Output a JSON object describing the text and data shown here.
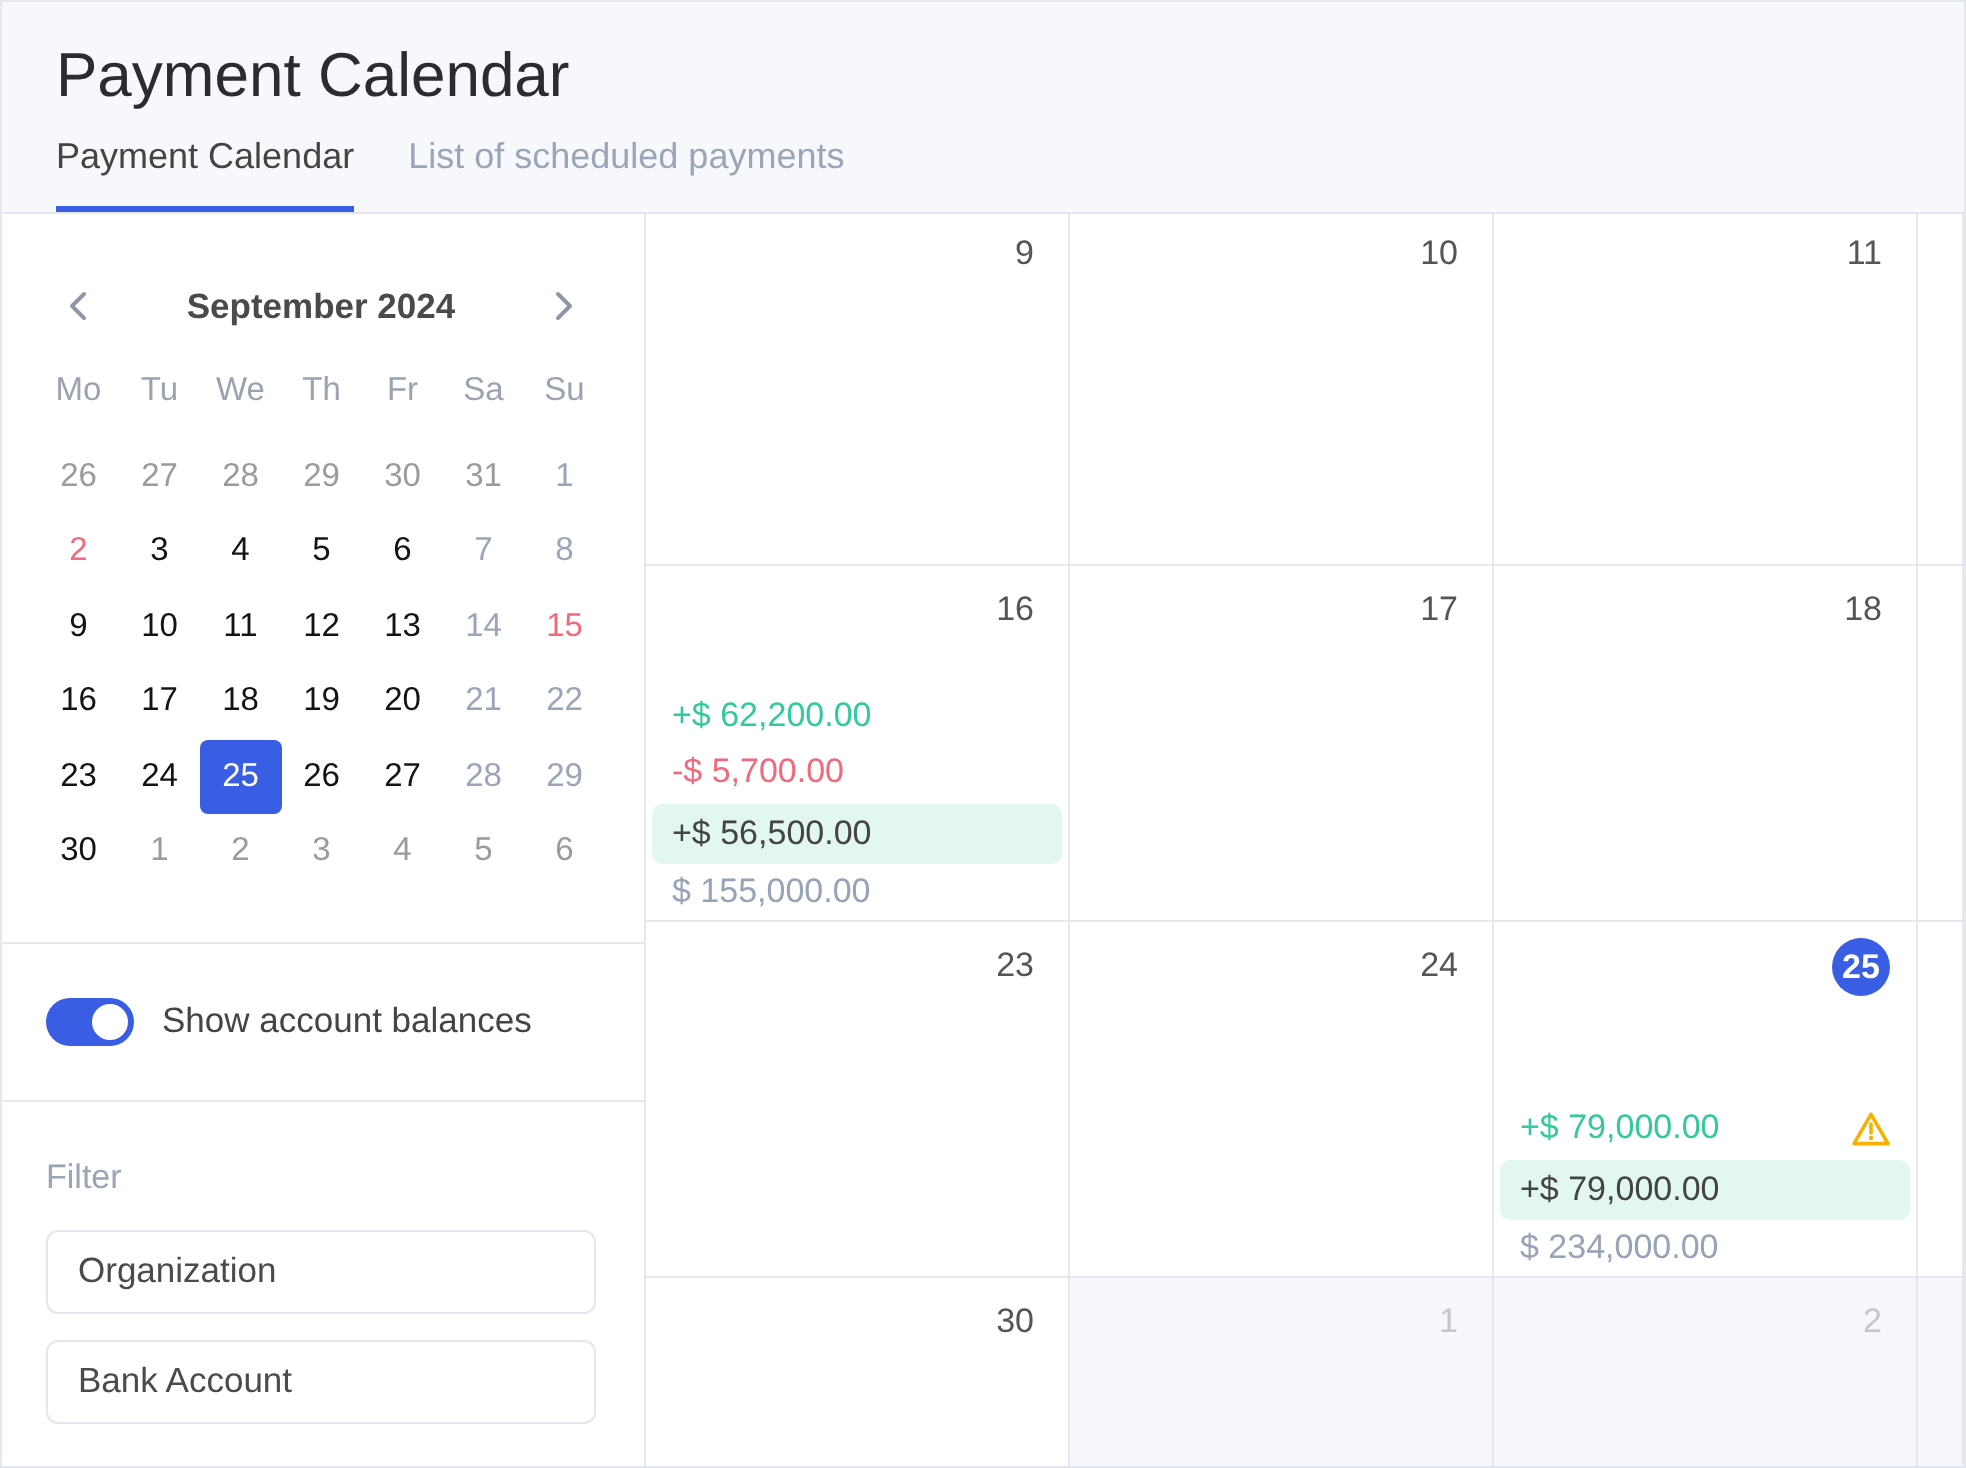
{
  "page": {
    "title": "Payment Calendar"
  },
  "tabs": [
    {
      "label": "Payment Calendar",
      "selected": true
    },
    {
      "label": "List of scheduled payments",
      "selected": false
    }
  ],
  "mini_calendar": {
    "month": "September 2024",
    "weekdays": [
      "Mo",
      "Tu",
      "We",
      "Th",
      "Fr",
      "Sa",
      "Su"
    ],
    "weeks": [
      [
        {
          "day": "26",
          "kind": "outside",
          "selected": false
        },
        {
          "day": "27",
          "kind": "outside",
          "selected": false
        },
        {
          "day": "28",
          "kind": "outside",
          "selected": false
        },
        {
          "day": "29",
          "kind": "outside",
          "selected": false
        },
        {
          "day": "30",
          "kind": "outside",
          "selected": false
        },
        {
          "day": "31",
          "kind": "outside",
          "selected": false
        },
        {
          "day": "1",
          "kind": "weekend",
          "selected": false
        }
      ],
      [
        {
          "day": "2",
          "kind": "holiday",
          "selected": false
        },
        {
          "day": "3",
          "kind": "workday",
          "selected": false
        },
        {
          "day": "4",
          "kind": "workday",
          "selected": false
        },
        {
          "day": "5",
          "kind": "workday",
          "selected": false
        },
        {
          "day": "6",
          "kind": "workday",
          "selected": false
        },
        {
          "day": "7",
          "kind": "weekend",
          "selected": false
        },
        {
          "day": "8",
          "kind": "weekend",
          "selected": false
        }
      ],
      [
        {
          "day": "9",
          "kind": "workday",
          "selected": false
        },
        {
          "day": "10",
          "kind": "workday",
          "selected": false
        },
        {
          "day": "11",
          "kind": "workday",
          "selected": false
        },
        {
          "day": "12",
          "kind": "workday",
          "selected": false
        },
        {
          "day": "13",
          "kind": "workday",
          "selected": false
        },
        {
          "day": "14",
          "kind": "weekend",
          "selected": false
        },
        {
          "day": "15",
          "kind": "holiday",
          "selected": false
        }
      ],
      [
        {
          "day": "16",
          "kind": "workday",
          "selected": false
        },
        {
          "day": "17",
          "kind": "workday",
          "selected": false
        },
        {
          "day": "18",
          "kind": "workday",
          "selected": false
        },
        {
          "day": "19",
          "kind": "workday",
          "selected": false
        },
        {
          "day": "20",
          "kind": "workday",
          "selected": false
        },
        {
          "day": "21",
          "kind": "weekend",
          "selected": false
        },
        {
          "day": "22",
          "kind": "weekend",
          "selected": false
        }
      ],
      [
        {
          "day": "23",
          "kind": "workday",
          "selected": false
        },
        {
          "day": "24",
          "kind": "workday",
          "selected": false
        },
        {
          "day": "25",
          "kind": "workday",
          "selected": true
        },
        {
          "day": "26",
          "kind": "workday",
          "selected": false
        },
        {
          "day": "27",
          "kind": "workday",
          "selected": false
        },
        {
          "day": "28",
          "kind": "weekend",
          "selected": false
        },
        {
          "day": "29",
          "kind": "weekend",
          "selected": false
        }
      ],
      [
        {
          "day": "30",
          "kind": "workday",
          "selected": false
        },
        {
          "day": "1",
          "kind": "outside",
          "selected": false
        },
        {
          "day": "2",
          "kind": "outside",
          "selected": false
        },
        {
          "day": "3",
          "kind": "outside",
          "selected": false
        },
        {
          "day": "4",
          "kind": "outside",
          "selected": false
        },
        {
          "day": "5",
          "kind": "outside",
          "selected": false
        },
        {
          "day": "6",
          "kind": "outside",
          "selected": false
        }
      ]
    ]
  },
  "show_balances": {
    "label": "Show account balances",
    "on": true
  },
  "filter": {
    "label": "Filter",
    "fields": [
      {
        "placeholder": "Organization"
      },
      {
        "placeholder": "Bank Account"
      }
    ]
  },
  "calendar": {
    "weeks": [
      [
        {
          "day": "9",
          "kind": "current"
        },
        {
          "day": "10",
          "kind": "current"
        },
        {
          "day": "11",
          "kind": "current"
        },
        {
          "kind": "current"
        }
      ],
      [
        {
          "day": "16",
          "kind": "current",
          "entries": [
            {
              "kind": "income",
              "amount": "+$ 62,200.00",
              "warning": false
            },
            {
              "kind": "expense",
              "amount": "-$ 5,700.00",
              "warning": false
            },
            {
              "kind": "net",
              "amount": "+$ 56,500.00",
              "warning": false
            },
            {
              "kind": "balance",
              "amount": "$ 155,000.00",
              "warning": false
            }
          ]
        },
        {
          "day": "17",
          "kind": "current"
        },
        {
          "day": "18",
          "kind": "current"
        },
        {
          "kind": "current"
        }
      ],
      [
        {
          "day": "23",
          "kind": "current"
        },
        {
          "day": "24",
          "kind": "current"
        },
        {
          "day": "25",
          "kind": "today",
          "entries": [
            {
              "kind": "income",
              "amount": "+$ 79,000.00",
              "warning": true
            },
            {
              "kind": "net",
              "amount": "+$ 79,000.00",
              "warning": false
            },
            {
              "kind": "balance",
              "amount": "$ 234,000.00",
              "warning": false
            }
          ]
        },
        {
          "kind": "current"
        }
      ],
      [
        {
          "day": "30",
          "kind": "current"
        },
        {
          "day": "1",
          "kind": "outside"
        },
        {
          "day": "2",
          "kind": "outside"
        },
        {
          "kind": "outside"
        }
      ]
    ]
  }
}
